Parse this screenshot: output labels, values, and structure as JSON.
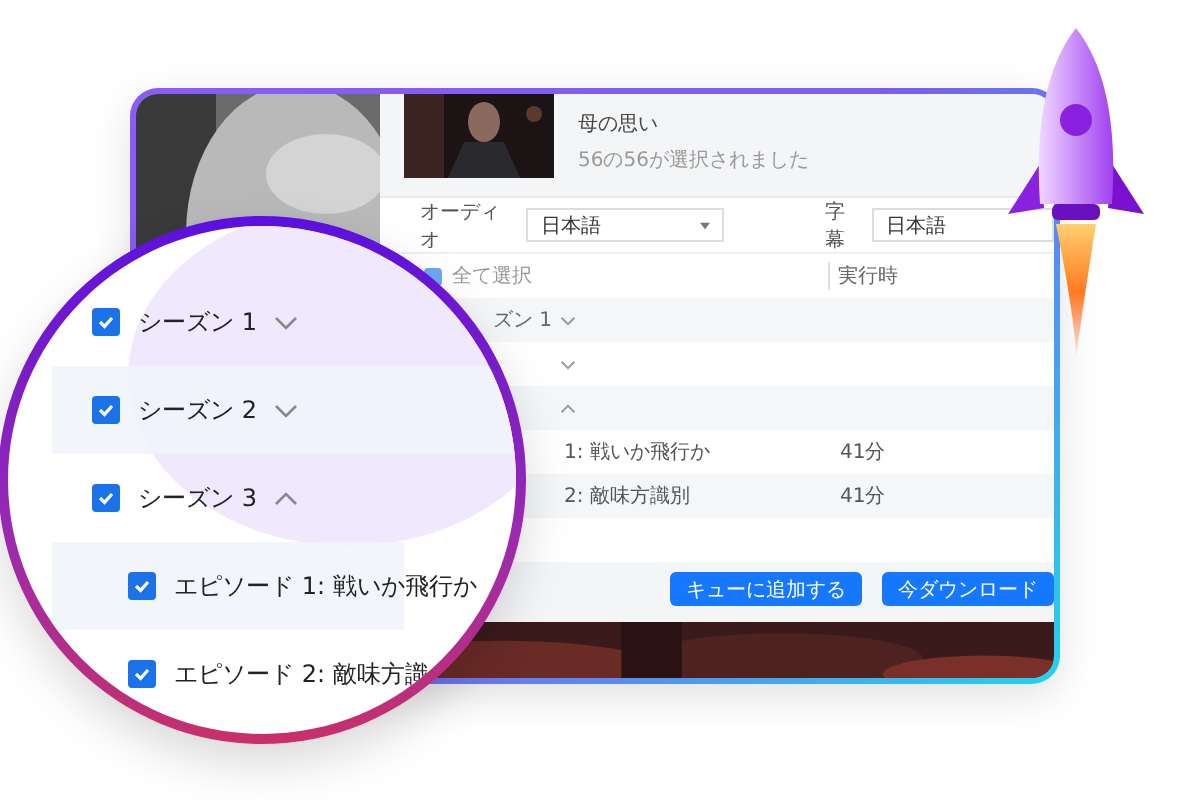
{
  "header": {
    "title": "母の思い",
    "subtitle": "56の56が選択されました"
  },
  "audio": {
    "label": "オーディオ",
    "value": "日本語"
  },
  "subtitles": {
    "label": "字幕",
    "value": "日本語"
  },
  "table": {
    "select_all": {
      "label": "全て選択",
      "checked": true
    },
    "columns": [
      "実行時"
    ],
    "rows": [
      {
        "kind": "season",
        "label": "ズン 1",
        "expanded": false
      },
      {
        "kind": "season",
        "expanded": false
      },
      {
        "kind": "season",
        "expanded": true
      },
      {
        "kind": "episode",
        "label": "1: 戦いか飛行か",
        "runtime": "41分"
      },
      {
        "kind": "episode",
        "label": "2: 敵味方識別",
        "runtime": "41分"
      }
    ]
  },
  "buttons": [
    "キューに追加する",
    "今ダウンロード"
  ],
  "lens": {
    "rows": [
      {
        "kind": "season",
        "label": "シーズン 1",
        "checked": true,
        "expanded": false
      },
      {
        "kind": "season",
        "label": "シーズン 2",
        "checked": true,
        "expanded": false
      },
      {
        "kind": "season",
        "label": "シーズン 3",
        "checked": true,
        "expanded": true
      },
      {
        "kind": "episode",
        "label": "エピソード 1: 戦いか飛行か",
        "checked": true
      },
      {
        "kind": "episode",
        "label": "エピソード 2: 敵味方識",
        "checked": true
      }
    ]
  }
}
